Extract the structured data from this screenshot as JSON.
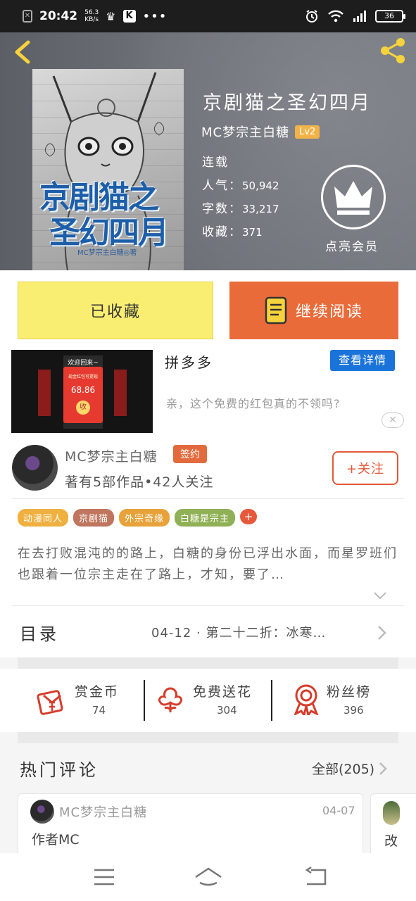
{
  "status_bar": {
    "time": "20:42",
    "net_speed": "56.3",
    "net_unit": "KB/s",
    "battery": "36"
  },
  "book": {
    "title": "京剧猫之圣幻四月",
    "author": "MC梦宗主白糖",
    "level": "Lv2",
    "status": "连载",
    "popularity_label": "人气：",
    "popularity": "50,942",
    "words_label": "字数：",
    "words": "33,217",
    "favorites_label": "收藏：",
    "favorites": "371",
    "cover_title_line1": "京剧猫之",
    "cover_title_line2": "圣幻四月",
    "cover_author": "MC梦宗主白糖◎著"
  },
  "vip": {
    "label": "点亮会员"
  },
  "actions": {
    "favorited_label": "已收藏",
    "continue_label": "继续阅读"
  },
  "ad": {
    "title": "拼多多",
    "detail_button": "查看详情",
    "description": "亲，这个免费的红包真的不领吗?",
    "img_header": "欢迎回来~",
    "img_amount": "68.86",
    "img_button": "收",
    "img_small": "现金红包可提现"
  },
  "author_panel": {
    "name": "MC梦宗主白糖",
    "badge": "签约",
    "stats": "著有5部作品•42人关注",
    "follow_label": "+关注"
  },
  "tags": [
    {
      "label": "动漫同人",
      "color": "#f0b040"
    },
    {
      "label": "京剧猫",
      "color": "#c0765e"
    },
    {
      "label": "外宗奇缘",
      "color": "#e7a23a"
    },
    {
      "label": "白糖是宗主",
      "color": "#8fb055"
    }
  ],
  "tag_more": "+",
  "synopsis": "在去打败混沌的的路上，白糖的身份已浮出水面，而星罗班们也跟着一位宗主走在了路上，才知，要了…",
  "toc": {
    "label": "目录",
    "latest": "04-12 · 第二十二折：冰寒…"
  },
  "rewards": [
    {
      "label": "赏金币",
      "count": "74"
    },
    {
      "label": "免费送花",
      "count": "304"
    },
    {
      "label": "粉丝榜",
      "count": "396"
    }
  ],
  "comments": {
    "title": "热门评论",
    "all_label": "全部(205)",
    "items": [
      {
        "user": "MC梦宗主白糖",
        "date": "04-07",
        "text": "作者MC"
      },
      {
        "text": "改"
      }
    ]
  },
  "colors": {
    "accent_orange": "#ea6b3a",
    "favorite_yellow": "#f9ee71",
    "detail_blue": "#1a73d9",
    "level_gold": "#f1b347"
  },
  "icons": [
    "back-icon",
    "share-icon",
    "crown-icon",
    "book-icon",
    "close-icon",
    "chevron-down-icon",
    "chevron-right-icon",
    "coin-envelope-icon",
    "flower-icon",
    "medal-icon",
    "menu-icon",
    "home-icon",
    "back-nav-icon"
  ]
}
